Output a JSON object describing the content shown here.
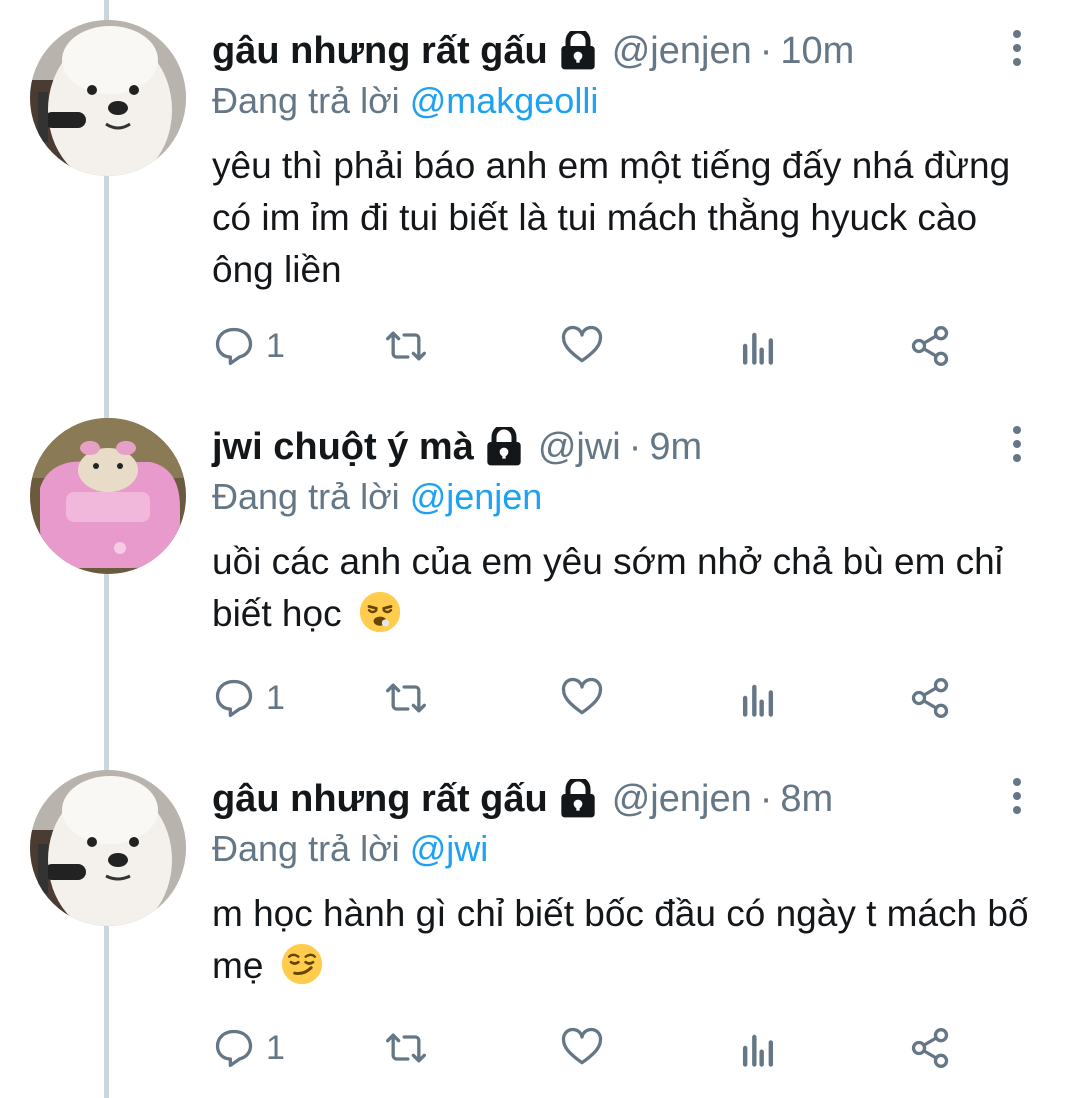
{
  "tweets": [
    {
      "display_name": "gâu nhưng rất gấu",
      "handle": "@jenjen",
      "separator": "·",
      "time": "10m",
      "reply_prefix": "Đang trả lời",
      "reply_to": "@makgeolli",
      "text": "yêu thì phải báo anh em một tiếng đấy nhá đừng có im ỉm đi tui biết là tui mách thằng hyuck cào ông liền",
      "emoji": "",
      "reply_count": "1",
      "avatar": "white-dog"
    },
    {
      "display_name": "jwi chuột ý mà",
      "handle": "@jwi",
      "separator": "·",
      "time": "9m",
      "reply_prefix": "Đang trả lời",
      "reply_to": "@jenjen",
      "text": "uồi các anh của em yêu sớm nhở chả bù em chỉ biết học",
      "emoji": "tired-face",
      "reply_count": "1",
      "avatar": "hamster-pink-car"
    },
    {
      "display_name": "gâu nhưng rất gấu",
      "handle": "@jenjen",
      "separator": "·",
      "time": "8m",
      "reply_prefix": "Đang trả lời",
      "reply_to": "@jwi",
      "text": "m học hành gì chỉ biết bốc đầu có ngày t mách bố mẹ",
      "emoji": "smirk-face",
      "reply_count": "1",
      "avatar": "white-dog"
    }
  ],
  "colors": {
    "text": "#14171a",
    "secondary": "#657786",
    "link": "#1da1f2",
    "thread_line": "#ccd6dd"
  }
}
